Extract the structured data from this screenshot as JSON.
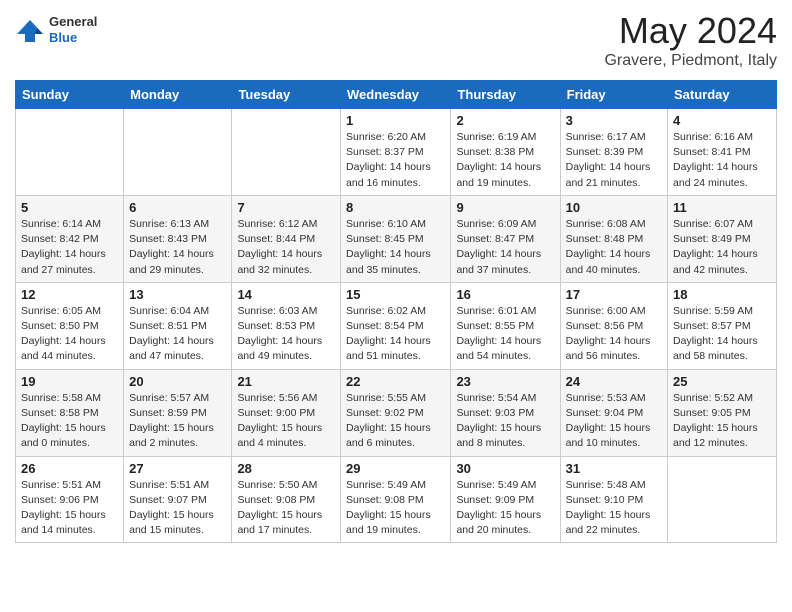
{
  "header": {
    "logo_general": "General",
    "logo_blue": "Blue",
    "month_title": "May 2024",
    "subtitle": "Gravere, Piedmont, Italy"
  },
  "weekdays": [
    "Sunday",
    "Monday",
    "Tuesday",
    "Wednesday",
    "Thursday",
    "Friday",
    "Saturday"
  ],
  "weeks": [
    [
      {
        "day": "",
        "sunrise": "",
        "sunset": "",
        "daylight": ""
      },
      {
        "day": "",
        "sunrise": "",
        "sunset": "",
        "daylight": ""
      },
      {
        "day": "",
        "sunrise": "",
        "sunset": "",
        "daylight": ""
      },
      {
        "day": "1",
        "sunrise": "Sunrise: 6:20 AM",
        "sunset": "Sunset: 8:37 PM",
        "daylight": "Daylight: 14 hours and 16 minutes."
      },
      {
        "day": "2",
        "sunrise": "Sunrise: 6:19 AM",
        "sunset": "Sunset: 8:38 PM",
        "daylight": "Daylight: 14 hours and 19 minutes."
      },
      {
        "day": "3",
        "sunrise": "Sunrise: 6:17 AM",
        "sunset": "Sunset: 8:39 PM",
        "daylight": "Daylight: 14 hours and 21 minutes."
      },
      {
        "day": "4",
        "sunrise": "Sunrise: 6:16 AM",
        "sunset": "Sunset: 8:41 PM",
        "daylight": "Daylight: 14 hours and 24 minutes."
      }
    ],
    [
      {
        "day": "5",
        "sunrise": "Sunrise: 6:14 AM",
        "sunset": "Sunset: 8:42 PM",
        "daylight": "Daylight: 14 hours and 27 minutes."
      },
      {
        "day": "6",
        "sunrise": "Sunrise: 6:13 AM",
        "sunset": "Sunset: 8:43 PM",
        "daylight": "Daylight: 14 hours and 29 minutes."
      },
      {
        "day": "7",
        "sunrise": "Sunrise: 6:12 AM",
        "sunset": "Sunset: 8:44 PM",
        "daylight": "Daylight: 14 hours and 32 minutes."
      },
      {
        "day": "8",
        "sunrise": "Sunrise: 6:10 AM",
        "sunset": "Sunset: 8:45 PM",
        "daylight": "Daylight: 14 hours and 35 minutes."
      },
      {
        "day": "9",
        "sunrise": "Sunrise: 6:09 AM",
        "sunset": "Sunset: 8:47 PM",
        "daylight": "Daylight: 14 hours and 37 minutes."
      },
      {
        "day": "10",
        "sunrise": "Sunrise: 6:08 AM",
        "sunset": "Sunset: 8:48 PM",
        "daylight": "Daylight: 14 hours and 40 minutes."
      },
      {
        "day": "11",
        "sunrise": "Sunrise: 6:07 AM",
        "sunset": "Sunset: 8:49 PM",
        "daylight": "Daylight: 14 hours and 42 minutes."
      }
    ],
    [
      {
        "day": "12",
        "sunrise": "Sunrise: 6:05 AM",
        "sunset": "Sunset: 8:50 PM",
        "daylight": "Daylight: 14 hours and 44 minutes."
      },
      {
        "day": "13",
        "sunrise": "Sunrise: 6:04 AM",
        "sunset": "Sunset: 8:51 PM",
        "daylight": "Daylight: 14 hours and 47 minutes."
      },
      {
        "day": "14",
        "sunrise": "Sunrise: 6:03 AM",
        "sunset": "Sunset: 8:53 PM",
        "daylight": "Daylight: 14 hours and 49 minutes."
      },
      {
        "day": "15",
        "sunrise": "Sunrise: 6:02 AM",
        "sunset": "Sunset: 8:54 PM",
        "daylight": "Daylight: 14 hours and 51 minutes."
      },
      {
        "day": "16",
        "sunrise": "Sunrise: 6:01 AM",
        "sunset": "Sunset: 8:55 PM",
        "daylight": "Daylight: 14 hours and 54 minutes."
      },
      {
        "day": "17",
        "sunrise": "Sunrise: 6:00 AM",
        "sunset": "Sunset: 8:56 PM",
        "daylight": "Daylight: 14 hours and 56 minutes."
      },
      {
        "day": "18",
        "sunrise": "Sunrise: 5:59 AM",
        "sunset": "Sunset: 8:57 PM",
        "daylight": "Daylight: 14 hours and 58 minutes."
      }
    ],
    [
      {
        "day": "19",
        "sunrise": "Sunrise: 5:58 AM",
        "sunset": "Sunset: 8:58 PM",
        "daylight": "Daylight: 15 hours and 0 minutes."
      },
      {
        "day": "20",
        "sunrise": "Sunrise: 5:57 AM",
        "sunset": "Sunset: 8:59 PM",
        "daylight": "Daylight: 15 hours and 2 minutes."
      },
      {
        "day": "21",
        "sunrise": "Sunrise: 5:56 AM",
        "sunset": "Sunset: 9:00 PM",
        "daylight": "Daylight: 15 hours and 4 minutes."
      },
      {
        "day": "22",
        "sunrise": "Sunrise: 5:55 AM",
        "sunset": "Sunset: 9:02 PM",
        "daylight": "Daylight: 15 hours and 6 minutes."
      },
      {
        "day": "23",
        "sunrise": "Sunrise: 5:54 AM",
        "sunset": "Sunset: 9:03 PM",
        "daylight": "Daylight: 15 hours and 8 minutes."
      },
      {
        "day": "24",
        "sunrise": "Sunrise: 5:53 AM",
        "sunset": "Sunset: 9:04 PM",
        "daylight": "Daylight: 15 hours and 10 minutes."
      },
      {
        "day": "25",
        "sunrise": "Sunrise: 5:52 AM",
        "sunset": "Sunset: 9:05 PM",
        "daylight": "Daylight: 15 hours and 12 minutes."
      }
    ],
    [
      {
        "day": "26",
        "sunrise": "Sunrise: 5:51 AM",
        "sunset": "Sunset: 9:06 PM",
        "daylight": "Daylight: 15 hours and 14 minutes."
      },
      {
        "day": "27",
        "sunrise": "Sunrise: 5:51 AM",
        "sunset": "Sunset: 9:07 PM",
        "daylight": "Daylight: 15 hours and 15 minutes."
      },
      {
        "day": "28",
        "sunrise": "Sunrise: 5:50 AM",
        "sunset": "Sunset: 9:08 PM",
        "daylight": "Daylight: 15 hours and 17 minutes."
      },
      {
        "day": "29",
        "sunrise": "Sunrise: 5:49 AM",
        "sunset": "Sunset: 9:08 PM",
        "daylight": "Daylight: 15 hours and 19 minutes."
      },
      {
        "day": "30",
        "sunrise": "Sunrise: 5:49 AM",
        "sunset": "Sunset: 9:09 PM",
        "daylight": "Daylight: 15 hours and 20 minutes."
      },
      {
        "day": "31",
        "sunrise": "Sunrise: 5:48 AM",
        "sunset": "Sunset: 9:10 PM",
        "daylight": "Daylight: 15 hours and 22 minutes."
      },
      {
        "day": "",
        "sunrise": "",
        "sunset": "",
        "daylight": ""
      }
    ]
  ]
}
